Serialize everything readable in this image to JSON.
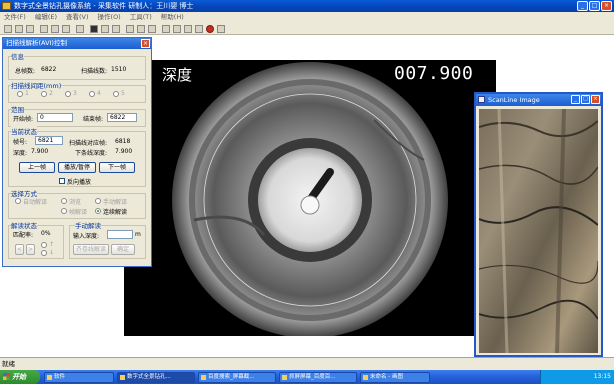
{
  "window": {
    "title": "数字式全景钻孔摄像系统 - 采集软件    研制人：王川婴  博士",
    "min": "_",
    "max": "□",
    "close": "×"
  },
  "menu": [
    "文件(F)",
    "编辑(E)",
    "查看(V)",
    "操作(O)",
    "工具(T)",
    "帮助(H)"
  ],
  "viewer": {
    "depth_label": "深度",
    "depth_value": "007.900"
  },
  "dialog": {
    "title": "扫描线解析(AVI)控制",
    "close": "×",
    "info": {
      "title": "信息",
      "total_frames_label": "总帧数:",
      "total_frames": "6822",
      "scan_lines_label": "扫描线数:",
      "scan_lines": "1510"
    },
    "interval": {
      "title": "扫描线间距(mm)",
      "options": [
        "1",
        "2",
        "3",
        "4",
        "5"
      ]
    },
    "range": {
      "title": "范围",
      "start_label": "开始帧:",
      "start_value": "0",
      "end_label": "结束帧:",
      "end_value": "6822"
    },
    "current": {
      "title": "当前状态",
      "frame_label": "帧号:",
      "frame_value": "6821",
      "scanline_frame_label": "扫描线对应帧:",
      "scanline_frame": "6818",
      "depth_label": "深度:",
      "depth": "7.900",
      "next_depth_label": "下条线深度:",
      "next_depth": "7.900"
    },
    "buttons": {
      "prev": "上一帧",
      "play": "播放/暂停",
      "next": "下一帧"
    },
    "reverse_label": "反向播放",
    "mode": {
      "title": "选择方式",
      "options": [
        "自动解译",
        "浏览",
        "手动解译",
        "帧解译",
        "连续解读"
      ]
    },
    "decode": {
      "title": "解读状态",
      "match_label": "匹配率:",
      "match_value": "0%",
      "arrow_left": "<",
      "arrow_right": ">",
      "radio_a": "↑",
      "radio_b": "↓"
    },
    "manual": {
      "title": "手动解读",
      "depth_label": "输入深度:",
      "depth_unit": "m",
      "confirm_scan": "齐卷线解读",
      "confirm": "确定"
    }
  },
  "scanwin": {
    "title": "ScanLine Image",
    "min": "_",
    "max": "□",
    "close": "×"
  },
  "status": {
    "text": "就绪"
  },
  "taskbar": {
    "start": "开始",
    "tasks": [
      "软件",
      "数字式全景钻孔...",
      "百度搜索_屏幕截...",
      "抓屏屏幕_百度百...",
      "未命名 - 画图"
    ],
    "clock": "13:15"
  },
  "colors": {
    "title_blue": "#0444b8",
    "dialog_face": "#ece9d8",
    "taskbar_blue": "#2460d8"
  }
}
